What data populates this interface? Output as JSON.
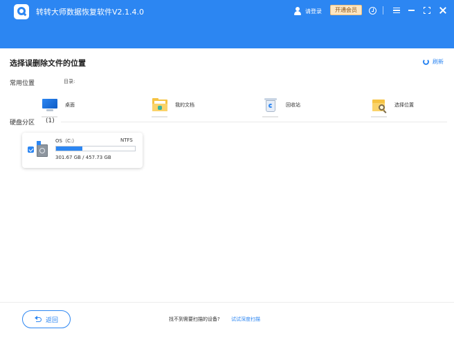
{
  "window": {
    "title": "转转大师数据恢复软件V2.1.4.0",
    "login_label": "请登录",
    "vip_label": "开通会员"
  },
  "header": {
    "title": "选择误删除文件的位置",
    "refresh_label": "刷新"
  },
  "common": {
    "label": "常用位置",
    "dir_label": "目录:",
    "items": [
      {
        "label": "桌面",
        "icon": "desktop-icon"
      },
      {
        "label": "我的文档",
        "icon": "documents-folder-icon"
      },
      {
        "label": "回收站",
        "icon": "recycle-bin-icon"
      },
      {
        "label": "选择位置",
        "icon": "folder-search-icon"
      }
    ]
  },
  "disks": {
    "label": "硬盘分区",
    "count": "(1)",
    "items": [
      {
        "name": "OS（C:）",
        "fs": "NTFS",
        "size_text": "301.67 GB / 457.73 GB",
        "used_fraction": 0.33,
        "checked": true
      }
    ]
  },
  "footer": {
    "back_label": "返回",
    "hint": "找不到需要扫描的设备?",
    "link": "试试深度扫描"
  },
  "colors": {
    "accent": "#2c86f2",
    "vip_bg": "#fde6c2"
  }
}
